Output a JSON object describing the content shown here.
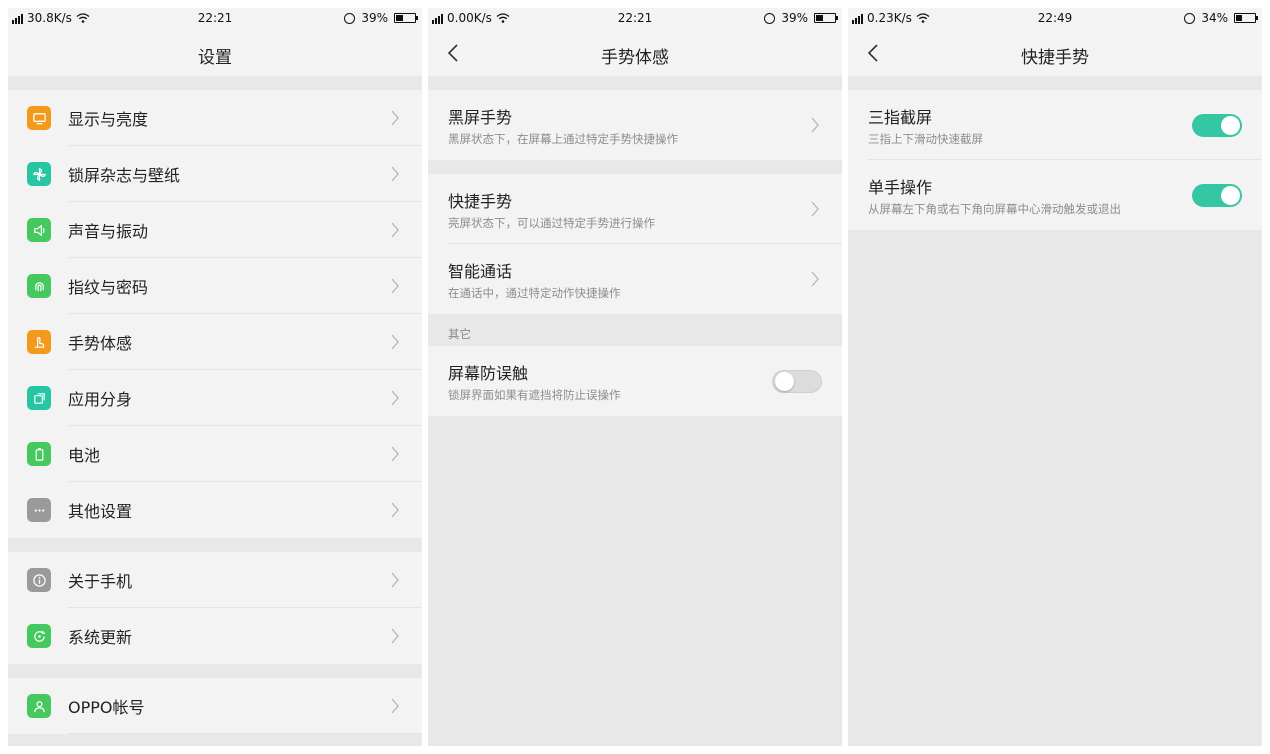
{
  "colors": {
    "accent_toggle": "#35c7a4",
    "orange": "#f39a1c",
    "teal": "#27c6a2",
    "green": "#45c95e",
    "gray": "#9a9a9a"
  },
  "screens": [
    {
      "status": {
        "speed": "30.8K/s",
        "time": "22:21",
        "battery": "39%",
        "battery_level": 0.39
      },
      "title": "设置",
      "groups": [
        [
          {
            "label": "显示与亮度",
            "icon": "display-icon",
            "color": "#f39a1c"
          },
          {
            "label": "锁屏杂志与壁纸",
            "icon": "pinwheel-icon",
            "color": "#27c6a2"
          },
          {
            "label": "声音与振动",
            "icon": "speaker-icon",
            "color": "#45c95e"
          },
          {
            "label": "指纹与密码",
            "icon": "fingerprint-icon",
            "color": "#45c95e"
          },
          {
            "label": "手势体感",
            "icon": "hand-icon",
            "color": "#f39a1c"
          },
          {
            "label": "应用分身",
            "icon": "clone-icon",
            "color": "#27c6a2"
          },
          {
            "label": "电池",
            "icon": "battery-icon",
            "color": "#45c95e"
          },
          {
            "label": "其他设置",
            "icon": "more-icon",
            "color": "#9a9a9a"
          }
        ],
        [
          {
            "label": "关于手机",
            "icon": "info-icon",
            "color": "#9a9a9a"
          },
          {
            "label": "系统更新",
            "icon": "update-icon",
            "color": "#45c95e"
          }
        ],
        [
          {
            "label": "OPPO帐号",
            "icon": "account-icon",
            "color": "#45c95e"
          }
        ]
      ]
    },
    {
      "status": {
        "speed": "0.00K/s",
        "time": "22:21",
        "battery": "39%",
        "battery_level": 0.39
      },
      "title": "手势体感",
      "items": [
        {
          "title": "黑屏手势",
          "subtitle": "黑屏状态下，在屏幕上通过特定手势快捷操作"
        },
        {
          "title": "快捷手势",
          "subtitle": "亮屏状态下，可以通过特定手势进行操作"
        },
        {
          "title": "智能通话",
          "subtitle": "在通话中，通过特定动作快捷操作"
        }
      ],
      "section": "其它",
      "toggle_item": {
        "title": "屏幕防误触",
        "subtitle": "锁屏界面如果有遮挡将防止误操作",
        "state": "off"
      }
    },
    {
      "status": {
        "speed": "0.23K/s",
        "time": "22:49",
        "battery": "34%",
        "battery_level": 0.34
      },
      "title": "快捷手势",
      "items": [
        {
          "title": "三指截屏",
          "subtitle": "三指上下滑动快速截屏",
          "state": "on"
        },
        {
          "title": "单手操作",
          "subtitle": "从屏幕左下角或右下角向屏幕中心滑动触发或退出",
          "state": "on"
        }
      ]
    }
  ]
}
